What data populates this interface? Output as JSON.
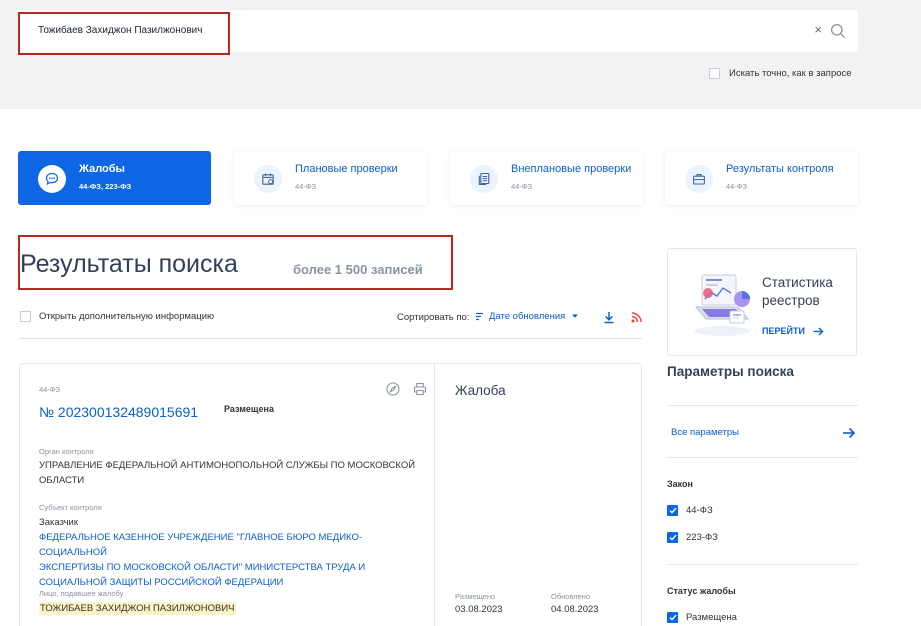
{
  "search": {
    "value": "Тожибаев Захиджон Пазилжонович",
    "clear_glyph": "×",
    "exact_label": "Искать точно, как в запросе"
  },
  "tiles": [
    {
      "title": "Жалобы",
      "sub": "44-ФЗ, 223-ФЗ",
      "icon": "chat-icon",
      "active": true
    },
    {
      "title": "Плановые проверки",
      "sub": "44-ФЗ",
      "icon": "calendar-icon",
      "active": false
    },
    {
      "title": "Внеплановые проверки",
      "sub": "44-ФЗ",
      "icon": "documents-icon",
      "active": false
    },
    {
      "title": "Результаты контроля",
      "sub": "44-ФЗ",
      "icon": "briefcase-icon",
      "active": false
    }
  ],
  "results": {
    "title": "Результаты поиска",
    "count": "более 1 500 записей",
    "open_info_label": "Открыть дополнительную информацию",
    "sort_label": "Сортировать по:",
    "sort_value": "Дате обновления"
  },
  "card": {
    "law": "44-ФЗ",
    "number": "№ 202300132489015691",
    "status": "Размещена",
    "organ_label": "Орган контроля",
    "organ_lines": [
      "УПРАВЛЕНИЕ ФЕДЕРАЛЬНОЙ АНТИМОНОПОЛЬНОЙ СЛУЖБЫ ПО МОСКОВСКОЙ",
      "ОБЛАСТИ"
    ],
    "subject_label": "Субъект контроля",
    "subject_role": "Заказчик",
    "subject_lines": [
      "ФЕДЕРАЛЬНОЕ КАЗЕННОЕ УЧРЕЖДЕНИЕ \"ГЛАВНОЕ БЮРО МЕДИКО-СОЦИАЛЬНОЙ",
      "ЭКСПЕРТИЗЫ ПО МОСКОВСКОЙ ОБЛАСТИ\" МИНИСТЕРСТВА ТРУДА И",
      "СОЦИАЛЬНОЙ ЗАЩИТЫ РОССИЙСКОЙ ФЕДЕРАЦИИ"
    ],
    "filer_label": "Лицо, подавшее жалобу",
    "filer_name": "ТОЖИБАЕВ ЗАХИДЖОН ПАЗИЛЖОНОВИЧ",
    "doc_type": "Жалоба",
    "posted_label": "Размещено",
    "posted_date": "03.08.2023",
    "updated_label": "Обновлено",
    "updated_date": "04.08.2023"
  },
  "stats": {
    "title_line1": "Статистика",
    "title_line2": "реестров",
    "go_label": "ПЕРЕЙТИ"
  },
  "params": {
    "title": "Параметры поиска",
    "all_params": "Все параметры",
    "law_group": "Закон",
    "law_options": [
      "44-ФЗ",
      "223-ФЗ"
    ],
    "status_group": "Статус жалобы",
    "status_options": [
      "Размещена"
    ]
  },
  "colors": {
    "accent": "#0d66e4",
    "link": "#0d5fc9",
    "highlight_box": "#b22a22",
    "rss": "#e8462a"
  }
}
